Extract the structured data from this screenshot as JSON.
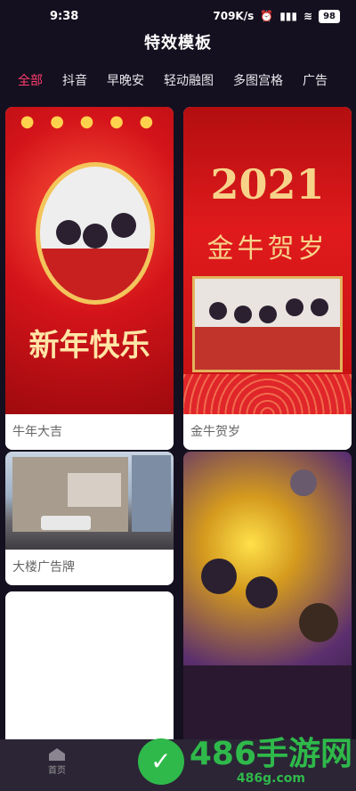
{
  "status": {
    "time": "9:38",
    "net": "709K/s",
    "battery": "98"
  },
  "header": {
    "title": "特效模板"
  },
  "tabs": [
    {
      "label": "全部"
    },
    {
      "label": "抖音"
    },
    {
      "label": "早晚安"
    },
    {
      "label": "轻动融图"
    },
    {
      "label": "多图宫格"
    },
    {
      "label": "广告"
    }
  ],
  "cards": [
    {
      "label": "牛年大吉",
      "image_text": "新年快乐"
    },
    {
      "label": "金牛贺岁",
      "image_year": "2021",
      "image_text": "金牛贺岁"
    },
    {
      "label": "大楼广告牌"
    },
    {
      "label": ""
    }
  ],
  "bottom_nav": {
    "home": "首页"
  },
  "watermark": {
    "main": "486手游网",
    "sub": "486g.com"
  },
  "colors": {
    "accent": "#ff3d6e",
    "bg": "#15101f"
  }
}
